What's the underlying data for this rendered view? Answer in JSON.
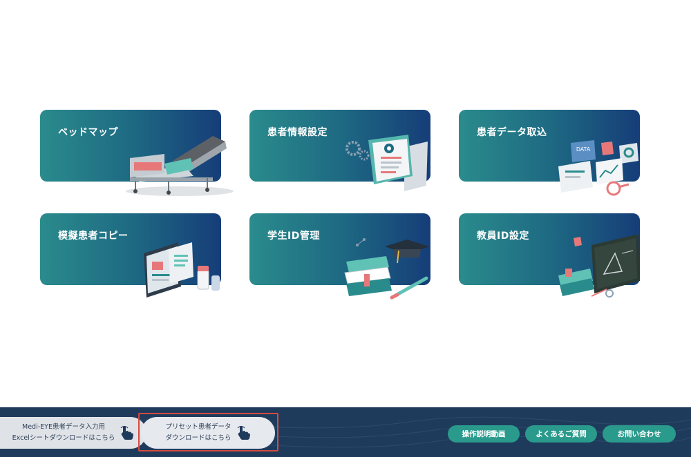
{
  "menu": {
    "cards": [
      {
        "label": "ベッドマップ",
        "icon": "hospital-bed-icon"
      },
      {
        "label": "患者情報設定",
        "icon": "patient-document-gears-icon"
      },
      {
        "label": "患者データ取込",
        "icon": "data-dashboard-icon"
      },
      {
        "label": "模擬患者コピー",
        "icon": "medical-records-copy-icon"
      },
      {
        "label": "学生ID管理",
        "icon": "graduation-books-icon"
      },
      {
        "label": "教員ID設定",
        "icon": "teacher-blackboard-icon"
      }
    ]
  },
  "footer": {
    "download1": {
      "line1": "Medi-EYE患者データ入力用",
      "line2": "Excelシートダウンロードはこちら"
    },
    "download2": {
      "line1": "プリセット患者データ",
      "line2": "ダウンロードはこちら"
    },
    "buttons": {
      "manual_video": "操作説明動画",
      "faq": "よくあるご質問",
      "contact": "お問い合わせ"
    }
  },
  "colors": {
    "card_gradient_start": "#2a8b8c",
    "card_gradient_end": "#163d78",
    "footer_bg": "#1f3b5c",
    "pill_button": "#2a9a8c",
    "highlight_border": "#d64a40"
  }
}
